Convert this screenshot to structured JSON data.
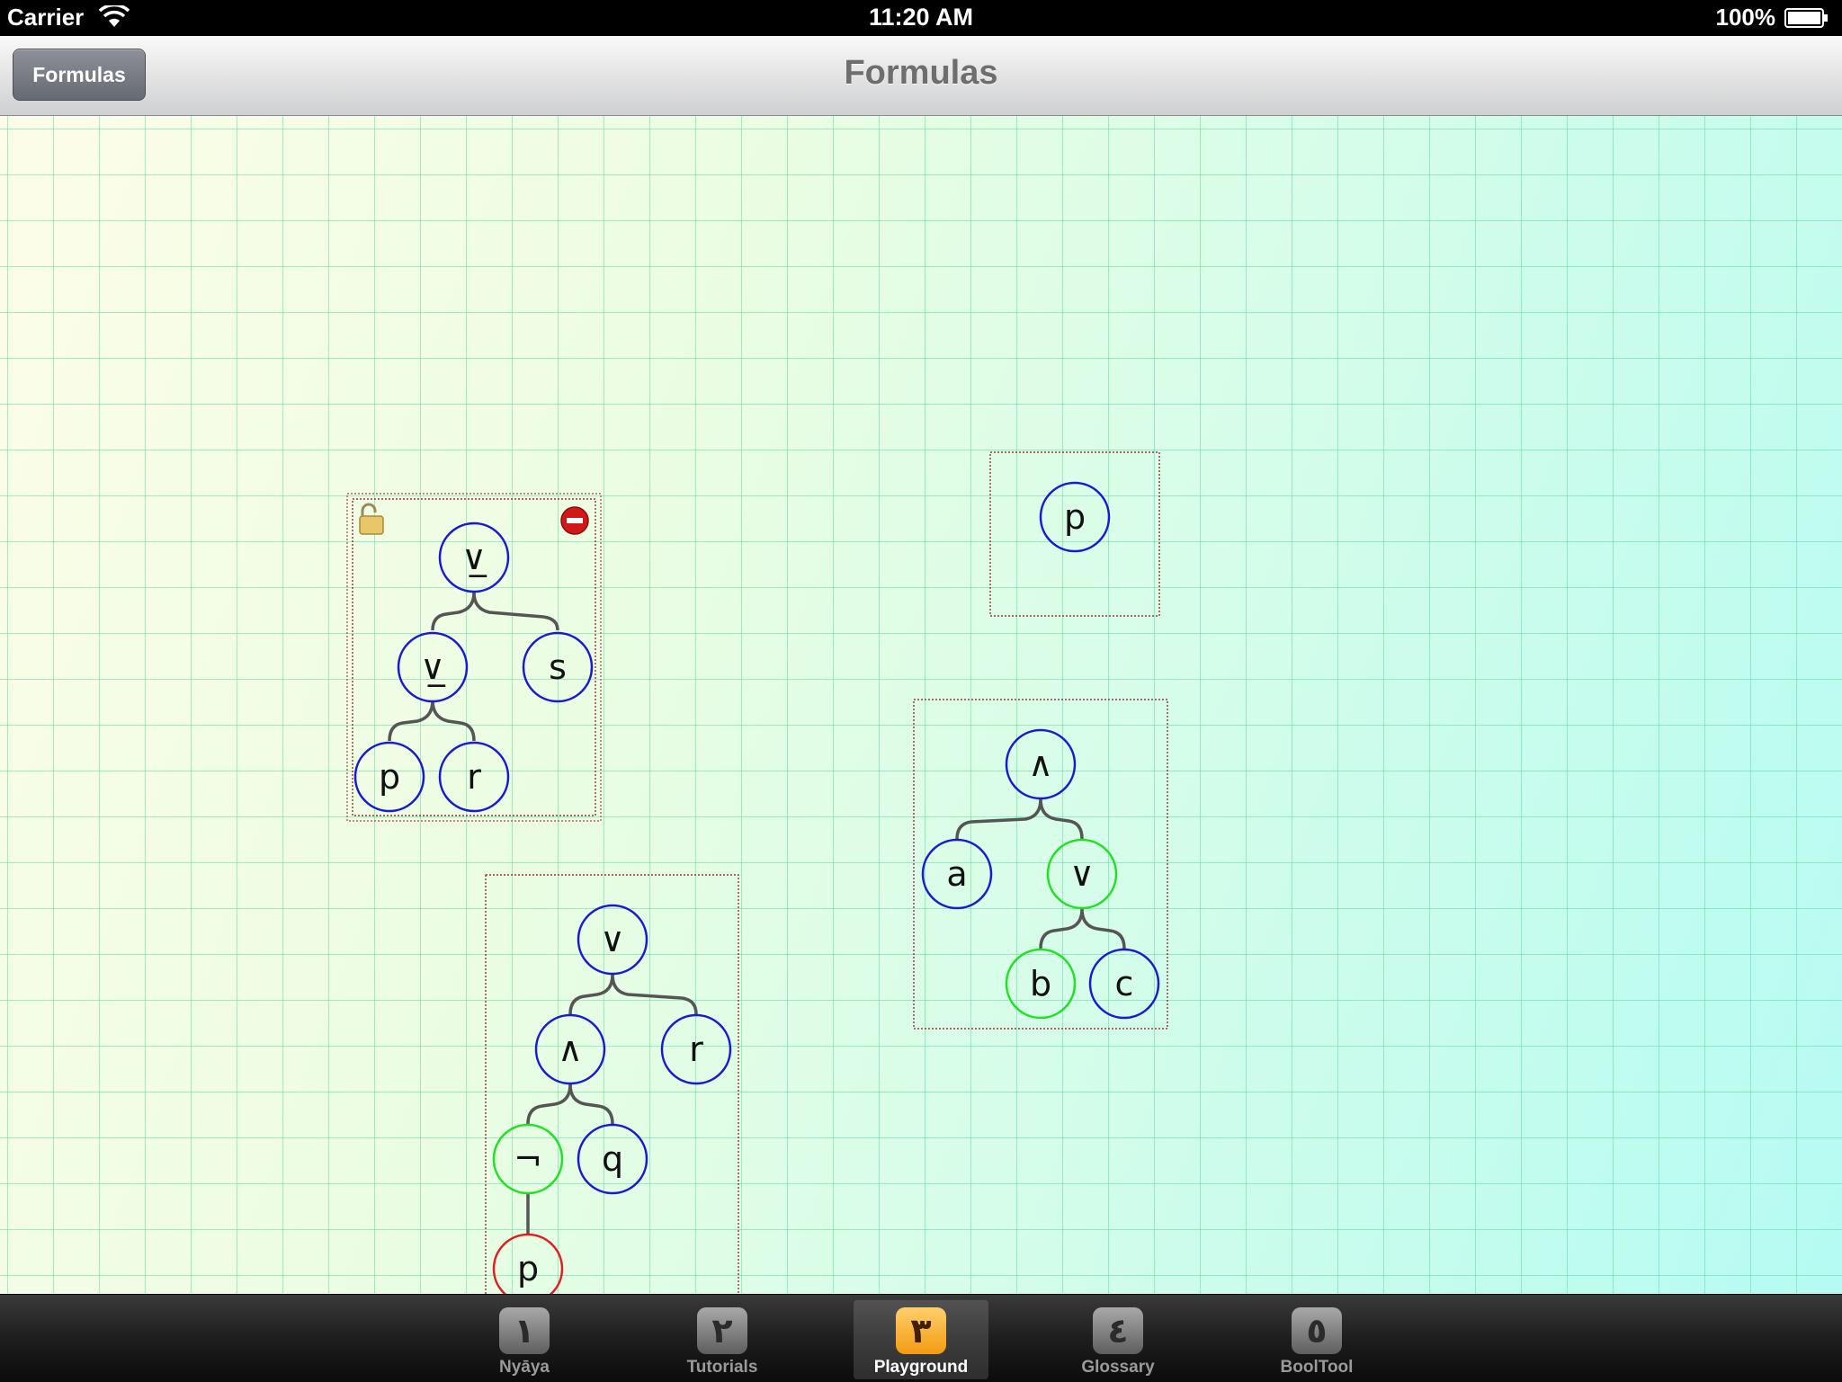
{
  "status_bar": {
    "carrier": "Carrier",
    "time": "11:20 AM",
    "battery": "100%"
  },
  "nav_bar": {
    "title": "Formulas",
    "back_label": "Formulas"
  },
  "tabs": [
    {
      "icon": "١",
      "label": "Nyāya",
      "selected": false
    },
    {
      "icon": "٢",
      "label": "Tutorials",
      "selected": false
    },
    {
      "icon": "٣",
      "label": "Playground",
      "selected": true
    },
    {
      "icon": "٤",
      "label": "Glossary",
      "selected": false
    },
    {
      "icon": "٥",
      "label": "BoolTool",
      "selected": false
    }
  ],
  "colors": {
    "normal_node": "#1a1ad6",
    "highlight_node": "#22e022",
    "error_node": "#e01e1e",
    "edge": "#555555"
  },
  "formulas": {
    "tree_1": {
      "selected": true,
      "locked": false,
      "nodes": [
        "∨̲",
        "∨̲",
        "s",
        "p",
        "r"
      ]
    },
    "tree_2": {
      "nodes": [
        "p"
      ]
    },
    "tree_3": {
      "nodes": [
        "∧",
        "a",
        "∨",
        "b",
        "c"
      ],
      "highlighted": [
        "∨",
        "b"
      ]
    },
    "tree_4": {
      "nodes": [
        "∨",
        "∧",
        "r",
        "¬",
        "q",
        "p"
      ],
      "highlighted": [
        "¬"
      ],
      "error": [
        "p"
      ]
    }
  }
}
